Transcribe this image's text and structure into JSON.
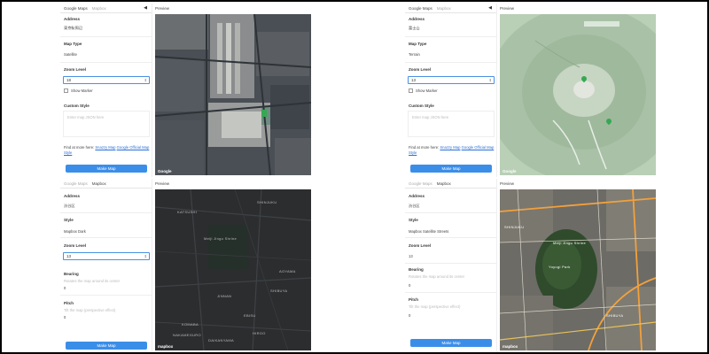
{
  "panels": [
    {
      "tabs": [
        "Google Maps",
        "Mapbox"
      ],
      "active_tab": 0,
      "address_label": "Address",
      "address_value": "東京駅周辺",
      "type_label": "Map Type",
      "type_value": "Satellite",
      "zoom_label": "Zoom Level",
      "zoom_value": "18",
      "show_marker": "Show Marker",
      "custom_style_label": "Custom Style",
      "custom_style_placeholder": "Enter map JSON here",
      "find_text": "Find at more here: ",
      "link1": "Snazzy Map",
      "link2": "Google Official Map Style",
      "button": "Make Map",
      "preview": "Preview",
      "map_logo": "Google"
    },
    {
      "tabs": [
        "Google Maps",
        "Mapbox"
      ],
      "active_tab": 0,
      "address_label": "Address",
      "address_value": "富士山",
      "type_label": "Map Type",
      "type_value": "Terrain",
      "zoom_label": "Zoom Level",
      "zoom_value": "13",
      "show_marker": "Show Marker",
      "custom_style_label": "Custom Style",
      "custom_style_placeholder": "Enter map JSON here",
      "find_text": "Find at more here: ",
      "link1": "Snazzy Map",
      "link2": "Google Official Map Style",
      "button": "Make Map",
      "preview": "Preview",
      "map_logo": "Google"
    },
    {
      "tabs": [
        "Google Maps",
        "Mapbox"
      ],
      "active_tab": 1,
      "address_label": "Address",
      "address_value": "渋谷区",
      "style_label": "Style",
      "style_value": "Mapbox Dark",
      "zoom_label": "Zoom Level",
      "zoom_value": "13",
      "bearing_label": "Bearing",
      "bearing_hint": "Rotates the map around its center",
      "bearing_value": "0",
      "pitch_label": "Pitch",
      "pitch_hint": "Tilt the map (perspective effect)",
      "pitch_value": "0",
      "button": "Make Map",
      "preview": "Preview",
      "map_logo": "mapbox",
      "map_labels": [
        "KATSUSHI",
        "SHIBUYA",
        "Meiji Jingu Shrine",
        "SHINJUKU",
        "HIROO",
        "JINNAN",
        "KOMABA",
        "EBISU",
        "NAKAMEGURO",
        "AOYAMA",
        "DAIKANYAMA"
      ]
    },
    {
      "tabs": [
        "Google Maps",
        "Mapbox"
      ],
      "active_tab": 1,
      "address_label": "Address",
      "address_value": "渋谷区",
      "style_label": "Style",
      "style_value": "Mapbox Satellite Streets",
      "zoom_label": "Zoom Level",
      "zoom_value": "13",
      "bearing_label": "Bearing",
      "bearing_hint": "Rotates the map around its center",
      "bearing_value": "0",
      "pitch_label": "Pitch",
      "pitch_hint": "Tilt the map (perspective effect)",
      "pitch_value": "0",
      "button": "Make Map",
      "preview": "Preview",
      "map_logo": "mapbox",
      "map_labels": [
        "Meiji Jingu Shrine",
        "Yoyogi Park",
        "SHINJUKU",
        "SHIBUYA"
      ]
    }
  ],
  "colors": {
    "accent": "#3b8ee8",
    "focus": "#4a90e2",
    "link": "#2a6fd6"
  }
}
